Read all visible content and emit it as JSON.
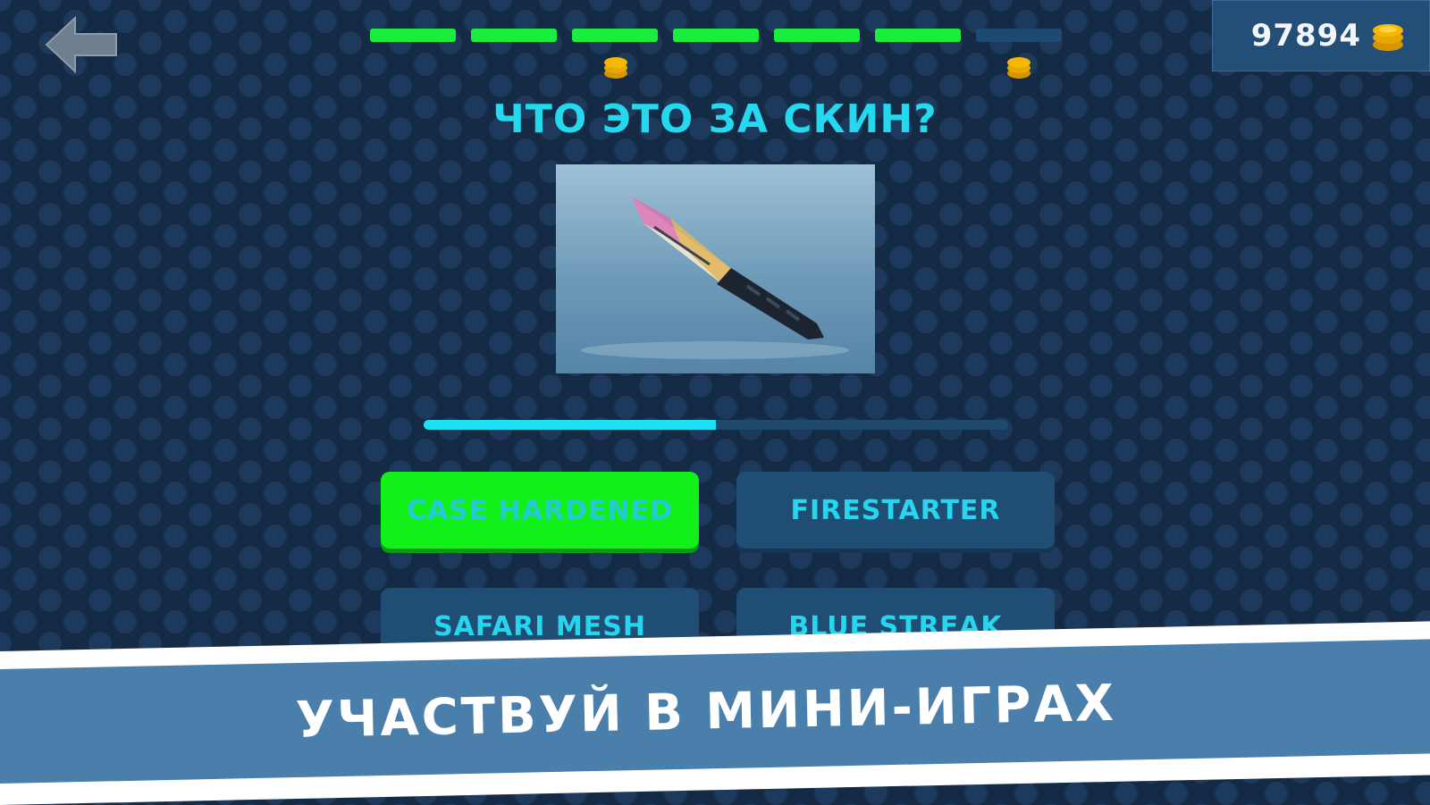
{
  "coins": {
    "count": "97894"
  },
  "progress": {
    "total_steps": 7,
    "completed_steps": 6
  },
  "question": "ЧТО ЭТО ЗА СКИН?",
  "timer": {
    "remaining_fraction": 0.5
  },
  "answers": [
    {
      "label": "CASE HARDENED",
      "state": "correct"
    },
    {
      "label": "FIRESTARTER",
      "state": "default"
    },
    {
      "label": "SAFARI MESH",
      "state": "default"
    },
    {
      "label": "BLUE STREAK",
      "state": "default"
    }
  ],
  "banner": {
    "text": "УЧАСТВУЙ В МИНИ-ИГРАХ"
  },
  "colors": {
    "done": "#19ee3c",
    "accent": "#24d8ee",
    "coin": "#f5b800"
  }
}
